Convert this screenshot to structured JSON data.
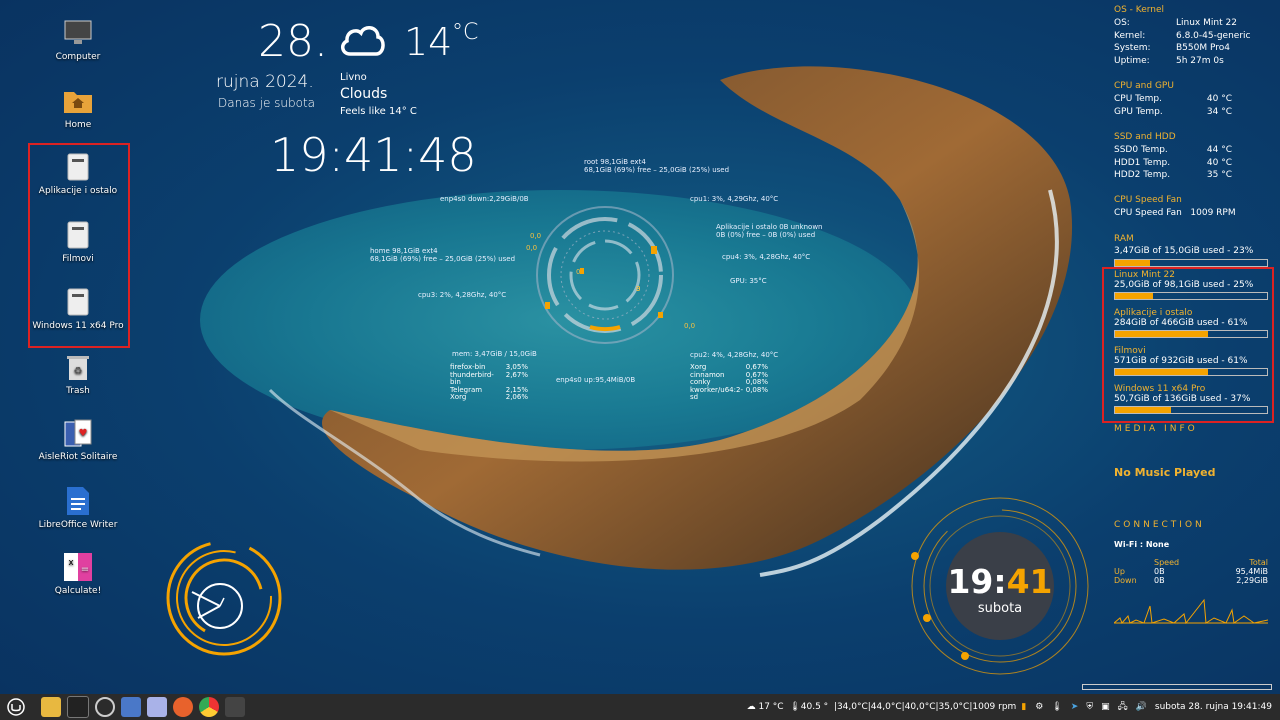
{
  "desktop_icons": [
    {
      "label": "Computer",
      "icon": "computer-icon"
    },
    {
      "label": "Home",
      "icon": "home-folder-icon"
    },
    {
      "label": "Aplikacije i ostalo",
      "icon": "drive-icon"
    },
    {
      "label": "Filmovi",
      "icon": "drive-icon"
    },
    {
      "label": "Windows 11 x64 Pro",
      "icon": "drive-icon"
    },
    {
      "label": "Trash",
      "icon": "trash-icon"
    },
    {
      "label": "AisleRiot Solitaire",
      "icon": "cards-icon"
    },
    {
      "label": "LibreOffice Writer",
      "icon": "writer-icon"
    },
    {
      "label": "Qalculate!",
      "icon": "calculator-icon"
    }
  ],
  "date_widget": {
    "day": "28.",
    "month_year": "rujna 2024.",
    "today": "Danas je subota"
  },
  "weather": {
    "temp": "14",
    "unit": "°C",
    "location": "Livno",
    "condition": "Clouds",
    "feels": "Feels like 14° C"
  },
  "time": "19:41:48",
  "ring": {
    "root": "root 98,1GiB ext4",
    "root_use": "68,1GiB (69%) free – 25,0GiB (25%) used",
    "enp_down": "enp4s0 down:2,29GiB/0B",
    "cpu1": "cpu1: 3%, 4,29Ghz, 40°C",
    "apps": "Aplikacije i ostalo 0B unknown",
    "apps_use": "0B (0%) free – 0B (0%) used",
    "home": "home 98,1GiB ext4",
    "home_use": "68,1GiB (69%) free – 25,0GiB (25%) used",
    "cpu4": "cpu4: 3%, 4,28Ghz, 40°C",
    "cpu3": "cpu3: 2%, 4,28Ghz, 40°C",
    "gpu": "GPU: 35°C",
    "mem": "mem: 3,47GiB / 15,0GiB",
    "cpu2": "cpu2: 4%, 4,28Ghz, 40°C",
    "enp_up": "enp4s0 up:95,4MiB/0B",
    "proc_left": [
      [
        "firefox-bin",
        "3,05%"
      ],
      [
        "thunderbird-bin",
        "2,67%"
      ],
      [
        "Telegram",
        "2,15%"
      ],
      [
        "Xorg",
        "2,06%"
      ]
    ],
    "proc_right": [
      [
        "Xorg",
        "0,67%"
      ],
      [
        "cinnamon",
        "0,67%"
      ],
      [
        "conky",
        "0,08%"
      ],
      [
        "kworker/u64:2-sd",
        "0,08%"
      ]
    ],
    "small": [
      "0,0",
      "0,0",
      "0",
      "0",
      "0,0",
      "0,0",
      "3"
    ]
  },
  "panel": {
    "os_h": "OS - Kernel",
    "os": [
      [
        "OS:",
        "Linux Mint 22"
      ],
      [
        "Kernel:",
        "6.8.0-45-generic"
      ],
      [
        "System:",
        "B550M Pro4"
      ],
      [
        "Uptime:",
        "5h 27m 0s"
      ]
    ],
    "cpu_h": "CPU and GPU",
    "cpu": [
      [
        "CPU Temp.",
        "40 °C"
      ],
      [
        "GPU Temp.",
        "34 °C"
      ]
    ],
    "ssd_h": "SSD and HDD",
    "ssd": [
      [
        "SSD0 Temp.",
        "44 °C"
      ],
      [
        "HDD1 Temp.",
        "40 °C"
      ],
      [
        "HDD2 Temp.",
        "35 °C"
      ]
    ],
    "fan_h": "CPU Speed Fan",
    "fan_label": "CPU Speed Fan",
    "fan_val": "1009  RPM",
    "ram_h": "RAM",
    "ram": "3,47GiB of 15,0GiB used - 23%",
    "ram_pct": 23,
    "disks": [
      {
        "name": "Linux Mint 22",
        "use": "25,0GiB of 98,1GiB used - 25%",
        "pct": 25
      },
      {
        "name": "Aplikacije i ostalo",
        "use": "284GiB of 466GiB used - 61%",
        "pct": 61
      },
      {
        "name": "Filmovi",
        "use": "571GiB of 932GiB used - 61%",
        "pct": 61
      },
      {
        "name": "Windows 11 x64 Pro",
        "use": "50,7GiB of 136GiB used - 37%",
        "pct": 37
      }
    ],
    "media_h": "MEDIA INFO",
    "media": "No Music Played",
    "conn_h": "CONNECTION",
    "wifi": "Wi-Fi : None",
    "speed_h": "Speed",
    "total_h": "Total",
    "up": [
      "Up",
      "0B",
      "95,4MiB"
    ],
    "down": [
      "Down",
      "0B",
      "2,29GiB"
    ]
  },
  "big_clock": {
    "hh": "19",
    "mm": "41",
    "day": "subota"
  },
  "taskbar": {
    "weather": "17 °C",
    "temp": "40.5 °",
    "sensors": "|34,0°C|44,0°C|40,0°C|35,0°C|",
    "rpm": "1009 rpm",
    "clock": "subota 28. rujna  19:41:49"
  },
  "colors": {
    "accent": "#f5a300",
    "heading": "#f0b230",
    "red": "#d22222"
  }
}
